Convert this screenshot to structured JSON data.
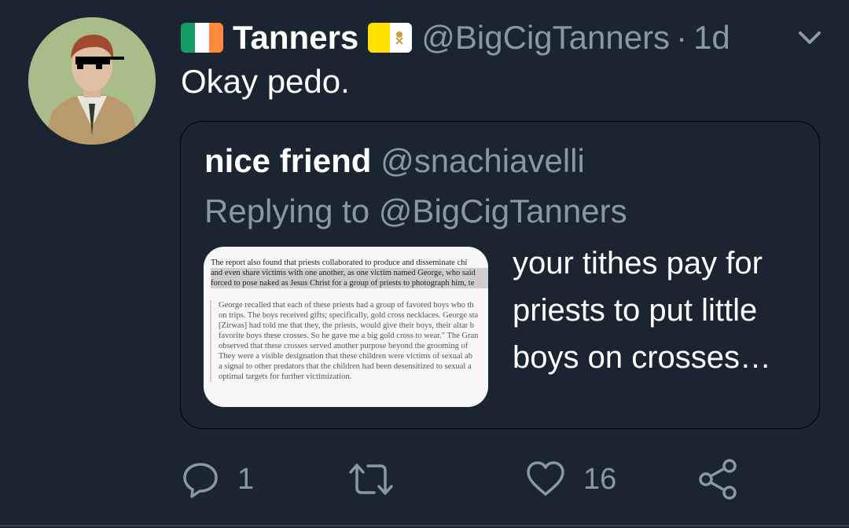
{
  "tweet": {
    "display_name": "Tanners",
    "handle": "@BigCigTanners",
    "separator": "·",
    "time": "1d",
    "text": "Okay pedo.",
    "flags": [
      "ireland-flag",
      "vatican-flag"
    ]
  },
  "quoted": {
    "display_name": "nice friend",
    "handle": "@snachiavelli",
    "replying_to": "Replying to @BigCigTanners",
    "text": "your tithes pay for priests to put little boys on crosses…",
    "image": {
      "paragraph_lines": [
        "The report also found that priests collaborated to produce and disseminate chi",
        "and even share victims with one another, as one victim named George, who said",
        "forced to pose naked as Jesus Christ for a group of priests to photograph him, te"
      ],
      "quote_lines": [
        "George recalled that each of these priests had a group of favored boys who th",
        "on trips. The boys received gifts; specifically, gold cross necklaces. George sta",
        "[Zirwas] had told me that they, the priests, would give their boys, their altar b",
        "favorite boys these crosses. So he gave me a big gold cross to wear.\" The Gran",
        "observed that these crosses served another purpose beyond the grooming of",
        "They were a visible designation that these children were victims of sexual ab",
        "a signal to other predators that the children had been desensitized to sexual a",
        "optimal targets for further victimization."
      ]
    }
  },
  "actions": {
    "reply_count": "1",
    "retweet_count": "",
    "like_count": "16"
  },
  "colors": {
    "background": "#1b2431",
    "secondary_text": "#8899a6"
  }
}
